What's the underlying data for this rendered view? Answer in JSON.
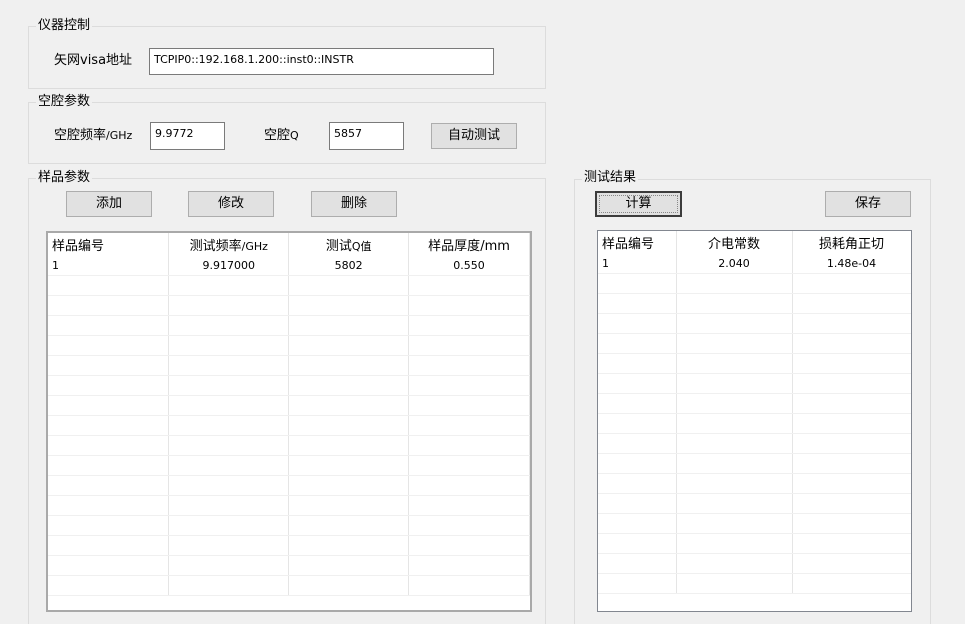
{
  "instrument": {
    "title": "仪器控制",
    "visa_label": "矢网visa地址",
    "visa_value": "TCPIP0::192.168.1.200::inst0::INSTR"
  },
  "cavity": {
    "title": "空腔参数",
    "freq_label": "空腔频率",
    "freq_unit": "/GHz",
    "freq_value": "9.9772",
    "q_label": "空腔",
    "q_unit": "Q",
    "q_value": "5857",
    "auto_test_label": "自动测试"
  },
  "sample": {
    "title": "样品参数",
    "add_label": "添加",
    "modify_label": "修改",
    "delete_label": "删除",
    "headers": [
      {
        "text": "样品编号",
        "unit": ""
      },
      {
        "text": "测试频率",
        "unit": "/GHz"
      },
      {
        "text": "测试",
        "unit": "Q值"
      },
      {
        "text": "样品厚度",
        "unit": "/mm"
      }
    ],
    "rows": [
      [
        "1",
        "9.917000",
        "5802",
        "0.550"
      ]
    ]
  },
  "results": {
    "title": "测试结果",
    "calc_label": "计算",
    "save_label": "保存",
    "headers": [
      "样品编号",
      "介电常数",
      "损耗角正切"
    ],
    "rows": [
      [
        "1",
        "2.040",
        "1.48e-04"
      ]
    ]
  }
}
